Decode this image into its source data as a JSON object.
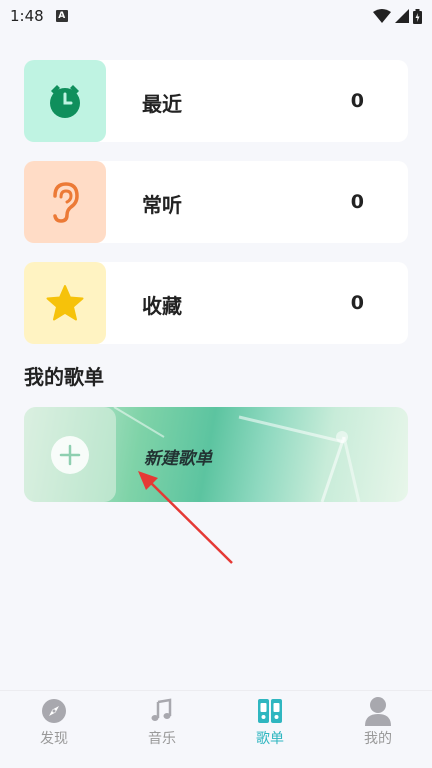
{
  "status": {
    "time": "1:48",
    "notif": "A"
  },
  "cards": [
    {
      "label": "最近",
      "count": "0",
      "icon": "alarm-clock-icon"
    },
    {
      "label": "常听",
      "count": "0",
      "icon": "ear-icon"
    },
    {
      "label": "收藏",
      "count": "0",
      "icon": "star-icon"
    }
  ],
  "section": {
    "title": "我的歌单"
  },
  "playlist": {
    "new_label": "新建歌单"
  },
  "nav": [
    {
      "label": "发现",
      "icon": "compass-icon"
    },
    {
      "label": "音乐",
      "icon": "music-note-icon"
    },
    {
      "label": "歌单",
      "icon": "playlist-icon"
    },
    {
      "label": "我的",
      "icon": "user-icon"
    }
  ],
  "colors": {
    "accent": "#2fb6c0",
    "annotation_arrow": "#e53935"
  }
}
